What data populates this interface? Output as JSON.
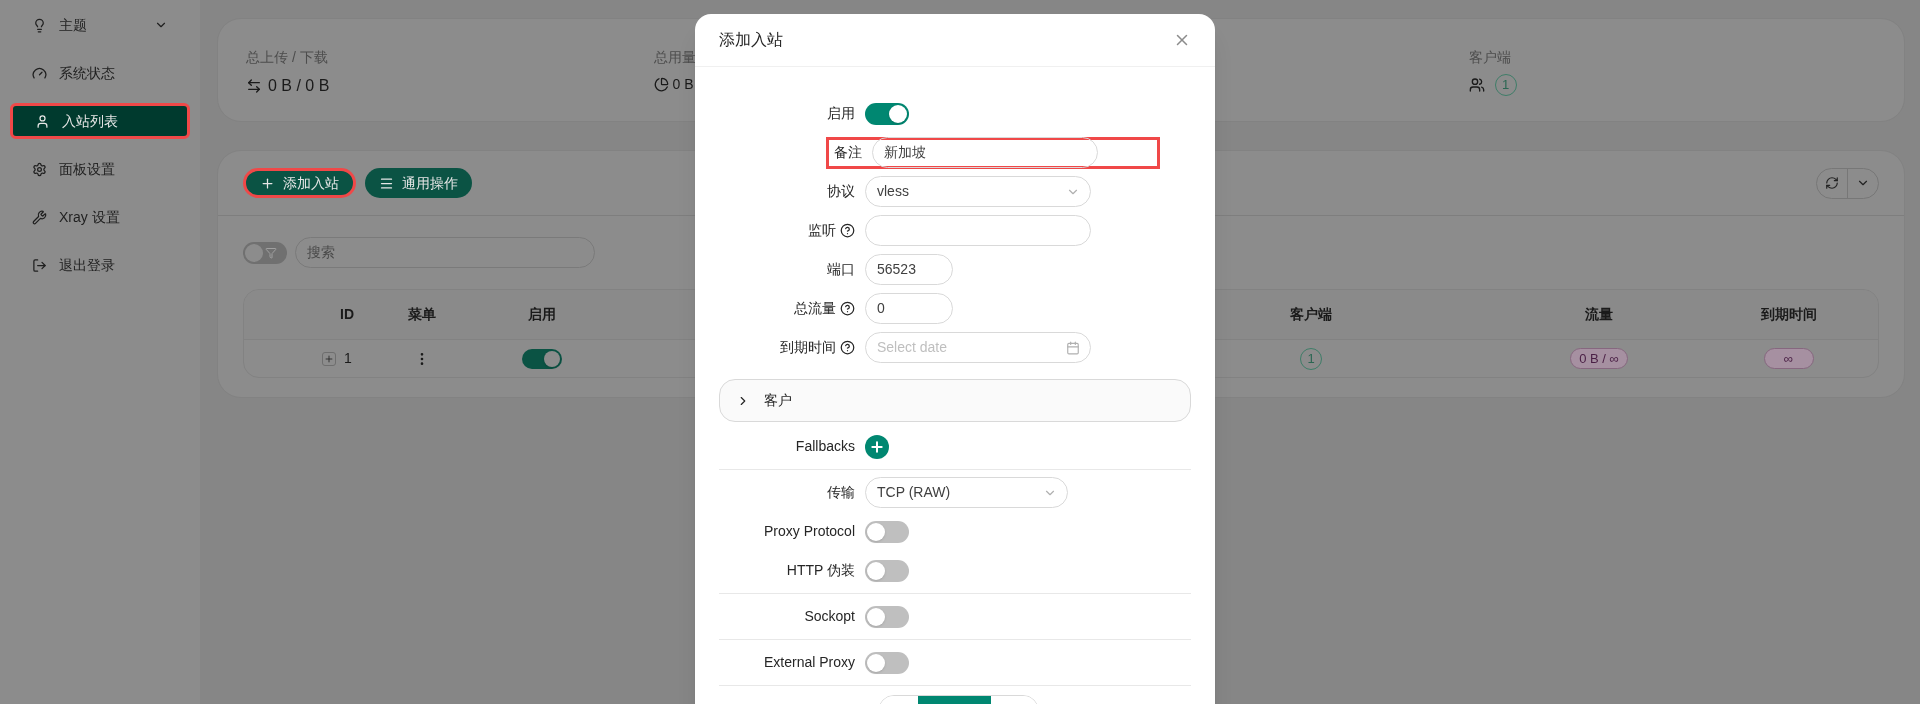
{
  "sidebar": {
    "items": [
      {
        "label": "主题",
        "kind": "submenu",
        "selected": false,
        "highlighted": false
      },
      {
        "label": "系统状态",
        "kind": "link",
        "selected": false,
        "highlighted": false
      },
      {
        "label": "入站列表",
        "kind": "link",
        "selected": true,
        "highlighted": true
      },
      {
        "label": "面板设置",
        "kind": "link",
        "selected": false,
        "highlighted": false
      },
      {
        "label": "Xray 设置",
        "kind": "link",
        "selected": false,
        "highlighted": false
      },
      {
        "label": "退出登录",
        "kind": "link",
        "selected": false,
        "highlighted": false
      }
    ]
  },
  "stats": [
    {
      "label": "总上传 / 下载",
      "value": "0 B / 0 B"
    },
    {
      "label": "总用量",
      "value": "0 B"
    },
    {
      "label": "客户端",
      "badge": "1"
    }
  ],
  "toolbar": {
    "buttons": [
      {
        "label": "添加入站",
        "highlighted": true
      },
      {
        "label": "通用操作",
        "highlighted": false
      }
    ]
  },
  "filter": {
    "on": false
  },
  "search": {
    "placeholder": "搜索"
  },
  "table": {
    "columns": [
      "ID",
      "菜单",
      "启用",
      "客户端",
      "流量",
      "到期时间"
    ],
    "rows": [
      {
        "id": "1",
        "enabled": true,
        "clients": "1",
        "traffic": "0 B / ∞",
        "expiry": "∞"
      }
    ]
  },
  "modal": {
    "title": "添加入站",
    "fields": [
      {
        "kind": "switch",
        "label": "启用",
        "on": true
      },
      {
        "kind": "input",
        "label": "备注",
        "value": "新加坡",
        "highlighted": true
      },
      {
        "kind": "select",
        "label": "协议",
        "value": "vless"
      },
      {
        "kind": "input",
        "label": "监听",
        "help": true
      },
      {
        "kind": "short-input",
        "label": "端口",
        "value": "56523"
      },
      {
        "kind": "short-input",
        "label": "总流量",
        "help": true,
        "value": "0"
      },
      {
        "kind": "date",
        "label": "到期时间",
        "help": true,
        "placeholder": "Select date"
      },
      {
        "kind": "panel",
        "label": "客户",
        "expanded": false
      },
      {
        "kind": "add",
        "label": "Fallbacks"
      },
      {
        "kind": "divider"
      },
      {
        "kind": "short-select",
        "label": "传输",
        "value": "TCP (RAW)"
      },
      {
        "kind": "switch",
        "label": "Proxy Protocol",
        "on": false
      },
      {
        "kind": "switch",
        "label": "HTTP 伪装",
        "on": false
      },
      {
        "kind": "divider"
      },
      {
        "kind": "switch",
        "label": "Sockopt",
        "on": false
      },
      {
        "kind": "divider"
      },
      {
        "kind": "switch",
        "label": "External Proxy",
        "on": false
      },
      {
        "kind": "divider"
      },
      {
        "kind": "segments",
        "segments": [
          {
            "selected": false
          },
          {
            "selected": true
          },
          {
            "selected": false
          }
        ]
      }
    ]
  }
}
